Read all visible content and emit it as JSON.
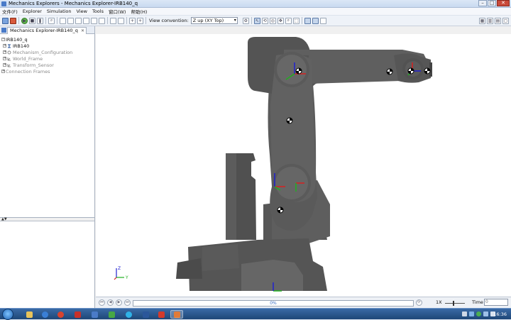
{
  "window": {
    "title": "Mechanics Explorers - Mechanics Explorer-IRB140_q"
  },
  "menu": [
    "文件(F)",
    "Explorer",
    "Simulation",
    "View",
    "Tools",
    "窗口(W)",
    "帮助(H)"
  ],
  "toolbar": {
    "view_convention_label": "View convention:",
    "view_convention_value": "Z up (XY Top)"
  },
  "panel": {
    "tab_label": "Mechanics Explorer-IRB140_q",
    "tree": [
      {
        "label": "IRB140_q",
        "icon": "minus-expander",
        "enabled": true
      },
      {
        "label": "IRB140",
        "icon": "model-icon",
        "enabled": true
      },
      {
        "label": "Mechanism_Configuration",
        "icon": "gear-icon",
        "enabled": false
      },
      {
        "label": "World_Frame",
        "icon": "frame-icon",
        "enabled": false
      },
      {
        "label": "Transform_Sensor",
        "icon": "frame-icon",
        "enabled": false
      },
      {
        "label": "Connection Frames",
        "icon": "plus-expander",
        "enabled": false
      }
    ]
  },
  "triad": {
    "z": "Z",
    "y": "Y"
  },
  "playback": {
    "progress_percent": 0,
    "progress_label": "0%",
    "speed": "1X",
    "time_label": "Time",
    "time_value": "0"
  },
  "taskbar": {
    "clock": "16:36"
  },
  "colors": {
    "robot": "#5a5a5a",
    "accent": "#3a6fc4",
    "axis_x": "#d62020",
    "axis_y": "#20b020",
    "axis_z": "#2020d0"
  }
}
